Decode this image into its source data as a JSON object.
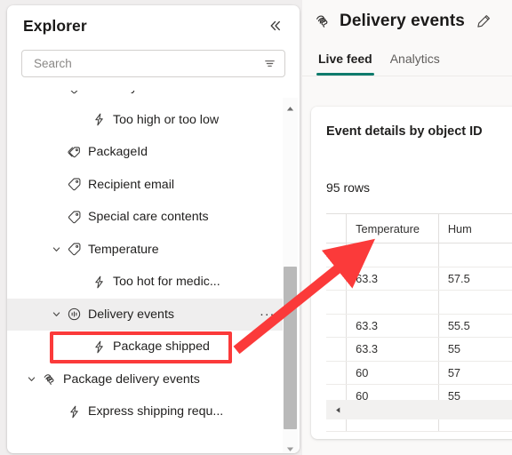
{
  "explorer": {
    "title": "Explorer",
    "collapse_icon": "chevron-double-left-icon",
    "search": {
      "placeholder": "Search",
      "value": "",
      "filter_icon": "filter-icon"
    },
    "tree_items": [
      {
        "label": "Humidity",
        "icon": "tag-icon",
        "indent": 1,
        "chevron": "expanded",
        "selected": false
      },
      {
        "label": "Too high or too low",
        "icon": "lightning-icon",
        "indent": 2,
        "chevron": "none",
        "selected": false
      },
      {
        "label": "PackageId",
        "icon": "tags-icon",
        "indent": 1,
        "chevron": "none",
        "selected": false
      },
      {
        "label": "Recipient email",
        "icon": "tag-icon",
        "indent": 1,
        "chevron": "none",
        "selected": false
      },
      {
        "label": "Special care contents",
        "icon": "tag-icon",
        "indent": 1,
        "chevron": "none",
        "selected": false
      },
      {
        "label": "Temperature",
        "icon": "tag-icon",
        "indent": 1,
        "chevron": "expanded",
        "selected": false
      },
      {
        "label": "Too hot for medic...",
        "icon": "lightning-icon",
        "indent": 2,
        "chevron": "none",
        "selected": false
      },
      {
        "label": "Delivery events",
        "icon": "signal-circle-icon",
        "indent": 1,
        "chevron": "expanded",
        "selected": true
      },
      {
        "label": "Package shipped",
        "icon": "lightning-icon",
        "indent": 2,
        "chevron": "none",
        "selected": false
      },
      {
        "label": "Package delivery events",
        "icon": "stream-icon",
        "indent": 0,
        "chevron": "expanded",
        "selected": false
      },
      {
        "label": "Express shipping requ...",
        "icon": "lightning-icon",
        "indent": 1,
        "chevron": "none",
        "selected": false
      }
    ],
    "overflow_menu_label": "...",
    "scrollbar": {
      "up_icon": "caret-up-icon",
      "down_icon": "caret-down-icon"
    }
  },
  "detail": {
    "icon": "stream-icon",
    "title": "Delivery events",
    "edit_icon": "pencil-icon",
    "tabs": [
      {
        "label": "Live feed",
        "active": true
      },
      {
        "label": "Analytics",
        "active": false
      }
    ],
    "accent_color": "#0e7b6c",
    "card": {
      "title": "Event details by object ID",
      "row_count": "95 rows",
      "columns": [
        "",
        "Temperature",
        "Hum"
      ],
      "rows": [
        [
          "",
          "",
          ""
        ],
        [
          "",
          "63.3",
          "57.5"
        ],
        [
          "",
          "",
          ""
        ],
        [
          "",
          "63.3",
          "55.5"
        ],
        [
          "",
          "63.3",
          "55"
        ],
        [
          "",
          "60",
          "57"
        ],
        [
          "",
          "60",
          "55"
        ],
        [
          "",
          "",
          ""
        ]
      ],
      "hscroll_left_icon": "caret-left-icon"
    }
  },
  "annotations": {
    "highlight_color": "#fb3a3a",
    "box_target": "Delivery events",
    "arrow_target": "Temperature column"
  }
}
